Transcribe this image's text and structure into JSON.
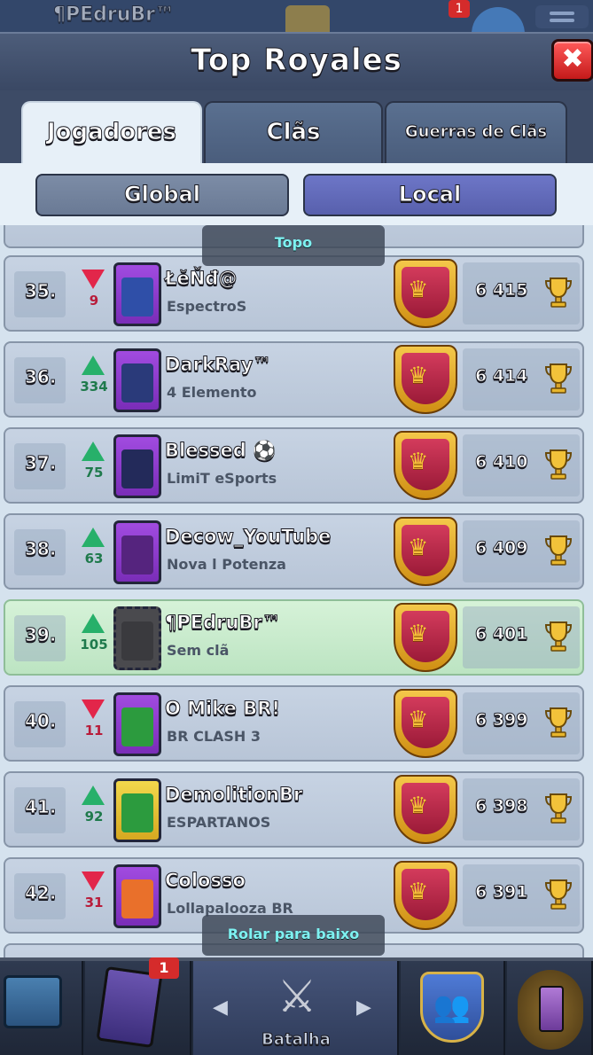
{
  "topbar": {
    "player_name": "¶PEdruBr™",
    "notification_count": "1"
  },
  "header": {
    "title": "Top Royales",
    "close_label": "✖"
  },
  "tabs": [
    {
      "label": "Jogadores",
      "active": true
    },
    {
      "label": "Clãs",
      "active": false
    },
    {
      "label": "Guerras de Clãs",
      "active": false
    }
  ],
  "subtabs": [
    {
      "label": "Global",
      "active": false
    },
    {
      "label": "Local",
      "active": true
    }
  ],
  "pills": {
    "top": "Topo",
    "scroll_down": "Rolar para baixo"
  },
  "rows": [
    {
      "rank": "35.",
      "direction": "down",
      "change": "9",
      "name": "ŁĕŇđ@",
      "clan": "EspectroS",
      "trophies": "6 415",
      "badge": "purple",
      "emblem": "blue",
      "emblem_icon": "flame-icon",
      "me": false
    },
    {
      "rank": "36.",
      "direction": "up",
      "change": "334",
      "name": "DarkRay™",
      "clan": "4 Elemento",
      "trophies": "6 414",
      "badge": "purple",
      "emblem": "navy",
      "emblem_icon": "skull-icon",
      "me": false
    },
    {
      "rank": "37.",
      "direction": "up",
      "change": "75",
      "name": "Blessed ⚽",
      "clan": "LimiT eSports",
      "trophies": "6 410",
      "badge": "purple",
      "emblem": "dnavy",
      "emblem_icon": "lotus-icon",
      "me": false
    },
    {
      "rank": "38.",
      "direction": "up",
      "change": "63",
      "name": "Decow_YouTube",
      "clan": "Nova l Potenza",
      "trophies": "6 409",
      "badge": "purple",
      "emblem": "violet",
      "emblem_icon": "star-burst-icon",
      "me": false
    },
    {
      "rank": "39.",
      "direction": "up",
      "change": "105",
      "name": "¶PEdruBr™",
      "clan": "Sem clã",
      "trophies": "6 401",
      "badge": "dark",
      "emblem": "none",
      "emblem_icon": "empty-badge-icon",
      "me": true
    },
    {
      "rank": "40.",
      "direction": "down",
      "change": "11",
      "name": "O Mike BR!",
      "clan": "BR CLASH 3",
      "trophies": "6 399",
      "badge": "purple",
      "emblem": "brazil",
      "emblem_icon": "brazil-flag-icon",
      "me": false
    },
    {
      "rank": "41.",
      "direction": "up",
      "change": "92",
      "name": "DemolitionBr",
      "clan": "ESPARTANOS",
      "trophies": "6 398",
      "badge": "yellow",
      "emblem": "brazil",
      "emblem_icon": "brazil-flag-icon",
      "me": false
    },
    {
      "rank": "42.",
      "direction": "down",
      "change": "31",
      "name": "Colosso",
      "clan": "Lollapalooza BR",
      "trophies": "6 391",
      "badge": "purple",
      "emblem": "orange",
      "emblem_icon": "diamond-icon",
      "me": false
    }
  ],
  "bottom_nav": {
    "battle_label": "Batalha",
    "cards_badge": "1"
  },
  "icons": {
    "trophy": "trophy-icon",
    "league": "crown-shield-icon",
    "up": "up-arrow-icon",
    "down": "down-arrow-icon"
  },
  "colors": {
    "up": "#27b06a",
    "down": "#e2264a",
    "local_tab": "#5860ad",
    "highlight_row": "#bce4c2"
  }
}
